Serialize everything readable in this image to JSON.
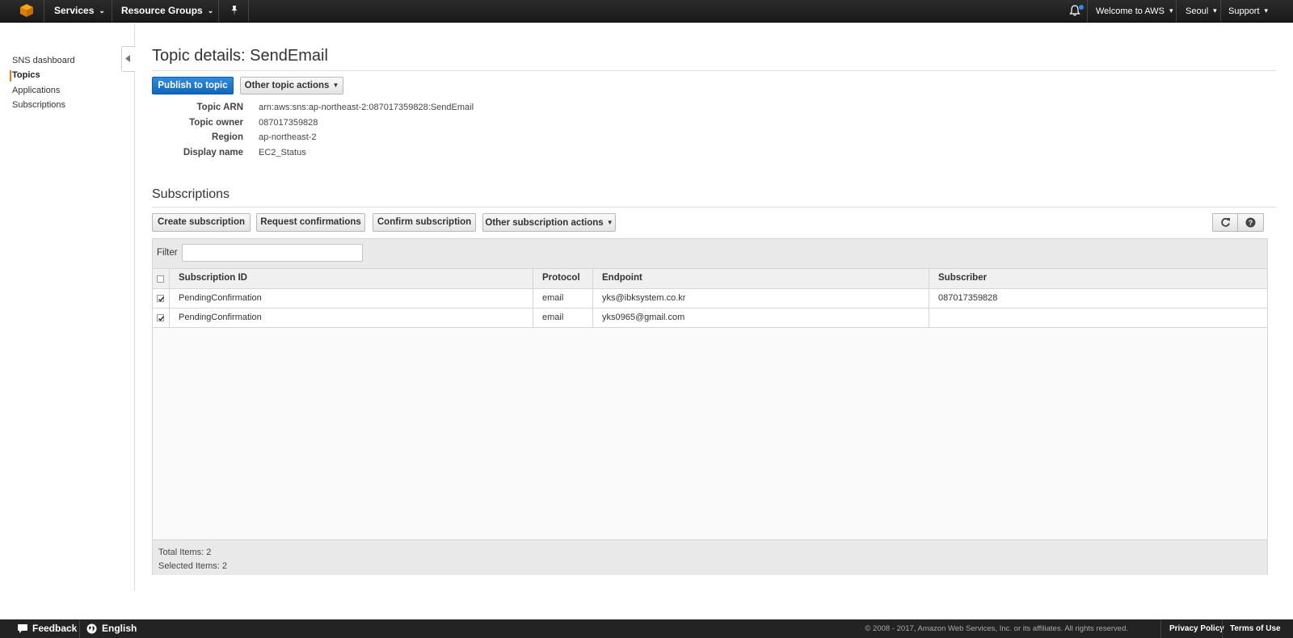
{
  "topbar": {
    "services_label": "Services",
    "resource_groups_label": "Resource Groups",
    "account_label": "Welcome to AWS",
    "region_label": "Seoul",
    "support_label": "Support"
  },
  "sidebar": {
    "items": [
      {
        "label": "SNS dashboard"
      },
      {
        "label": "Topics"
      },
      {
        "label": "Applications"
      },
      {
        "label": "Subscriptions"
      }
    ]
  },
  "topic": {
    "title": "Topic details: SendEmail",
    "publish_label": "Publish to topic",
    "other_actions_label": "Other topic actions",
    "details": [
      {
        "label": "Topic ARN",
        "value": "arn:aws:sns:ap-northeast-2:087017359828:SendEmail"
      },
      {
        "label": "Topic owner",
        "value": "087017359828"
      },
      {
        "label": "Region",
        "value": "ap-northeast-2"
      },
      {
        "label": "Display name",
        "value": "EC2_Status"
      }
    ]
  },
  "subscriptions": {
    "title": "Subscriptions",
    "buttons": {
      "create": "Create subscription",
      "request": "Request confirmations",
      "confirm": "Confirm subscription",
      "other": "Other subscription actions"
    },
    "filter_label": "Filter",
    "filter_value": "",
    "columns": [
      "Subscription ID",
      "Protocol",
      "Endpoint",
      "Subscriber"
    ],
    "rows": [
      {
        "checked": true,
        "id": "PendingConfirmation",
        "protocol": "email",
        "endpoint": "yks@ibksystem.co.kr",
        "subscriber": "087017359828"
      },
      {
        "checked": true,
        "id": "PendingConfirmation",
        "protocol": "email",
        "endpoint": "yks0965@gmail.com",
        "subscriber": ""
      }
    ],
    "total_items": "Total Items: 2",
    "selected_items": "Selected Items: 2"
  },
  "footer": {
    "feedback_label": "Feedback",
    "language_label": "English",
    "copyright": "© 2008 - 2017, Amazon Web Services, Inc. or its affiliates. All rights reserved.",
    "privacy_label": "Privacy Policy",
    "terms_label": "Terms of Use"
  },
  "colors": {
    "primary_button": "#1166bb",
    "active_marker": "#e47911",
    "notification_dot": "#2a8ce8",
    "nav_background": "#232323"
  }
}
